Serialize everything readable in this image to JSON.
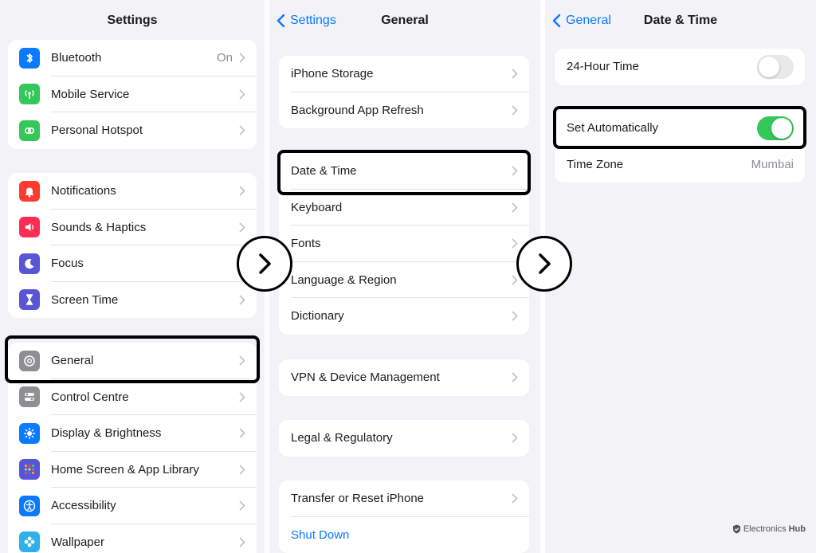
{
  "panel1": {
    "title": "Settings",
    "groups": [
      [
        {
          "label": "Bluetooth",
          "value": "On",
          "icon": "bluetooth-icon",
          "color": "#0a7aff"
        },
        {
          "label": "Mobile Service",
          "icon": "antenna-icon",
          "color": "#34c759"
        },
        {
          "label": "Personal Hotspot",
          "icon": "hotspot-icon",
          "color": "#34c759"
        }
      ],
      [
        {
          "label": "Notifications",
          "icon": "bell-icon",
          "color": "#ff3b30"
        },
        {
          "label": "Sounds & Haptics",
          "icon": "speaker-icon",
          "color": "#ff2d55"
        },
        {
          "label": "Focus",
          "icon": "moon-icon",
          "color": "#5856d6"
        },
        {
          "label": "Screen Time",
          "icon": "hourglass-icon",
          "color": "#5856d6"
        }
      ],
      [
        {
          "label": "General",
          "icon": "gear-icon",
          "color": "#8e8e93"
        },
        {
          "label": "Control Centre",
          "icon": "toggles-icon",
          "color": "#8e8e93"
        },
        {
          "label": "Display & Brightness",
          "icon": "sun-icon",
          "color": "#0a7aff"
        },
        {
          "label": "Home Screen & App Library",
          "icon": "app-grid-icon",
          "color": "#5856d6"
        },
        {
          "label": "Accessibility",
          "icon": "accessibility-icon",
          "color": "#0a7aff"
        },
        {
          "label": "Wallpaper",
          "icon": "flower-icon",
          "color": "#30b0e8"
        }
      ]
    ]
  },
  "panel2": {
    "back": "Settings",
    "title": "General",
    "groups": [
      [
        {
          "label": "iPhone Storage"
        },
        {
          "label": "Background App Refresh"
        }
      ],
      [
        {
          "label": "Date & Time"
        },
        {
          "label": "Keyboard"
        },
        {
          "label": "Fonts"
        },
        {
          "label": "Language & Region"
        },
        {
          "label": "Dictionary"
        }
      ],
      [
        {
          "label": "VPN & Device Management"
        }
      ],
      [
        {
          "label": "Legal & Regulatory"
        }
      ],
      [
        {
          "label": "Transfer or Reset iPhone"
        },
        {
          "label": "Shut Down",
          "link": true
        }
      ]
    ]
  },
  "panel3": {
    "back": "General",
    "title": "Date & Time",
    "hour24": {
      "label": "24-Hour Time",
      "on": false
    },
    "auto": {
      "label": "Set Automatically",
      "on": true
    },
    "timezone": {
      "label": "Time Zone",
      "value": "Mumbai"
    }
  },
  "watermark": {
    "part1": "Electronics",
    "part2": "Hub"
  }
}
